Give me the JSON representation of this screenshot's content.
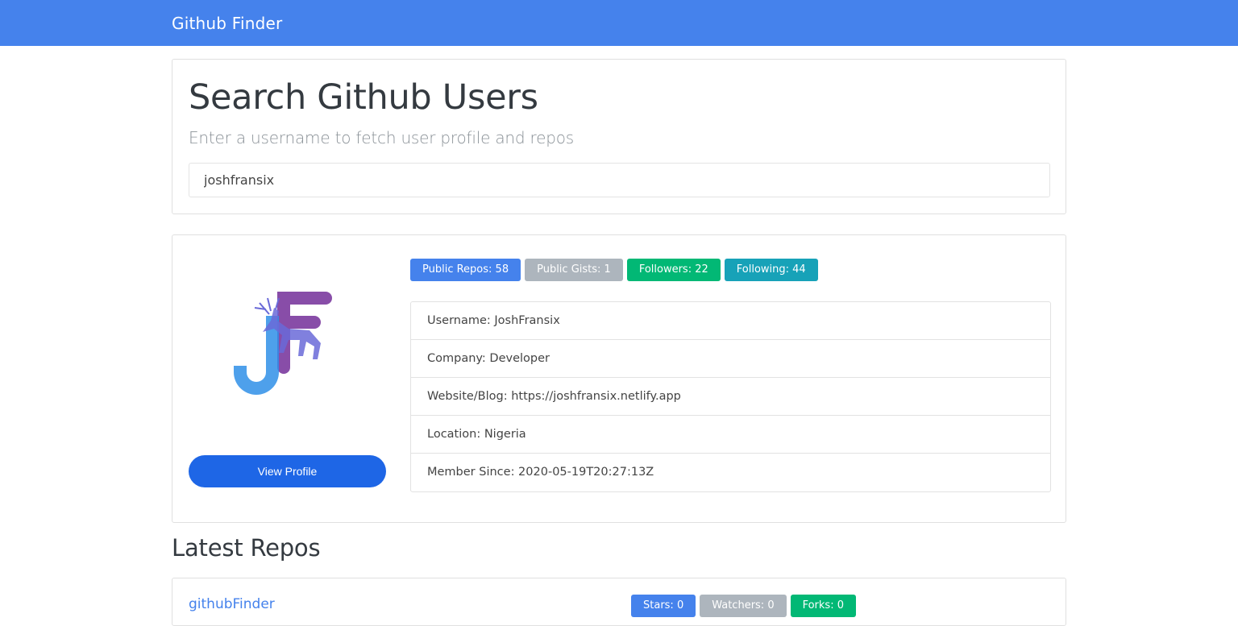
{
  "navbar": {
    "brand": "Github Finder"
  },
  "search": {
    "title": "Search Github Users",
    "subtitle": "Enter a username to fetch user profile and repos",
    "input_value": "joshfransix"
  },
  "profile": {
    "avatar_initials": "JF",
    "view_profile_label": "View Profile",
    "badges": [
      {
        "label": "Public Repos: 58",
        "color": "#4582ec"
      },
      {
        "label": "Public Gists: 1",
        "color": "#adb5bd"
      },
      {
        "label": "Followers: 22",
        "color": "#02b875"
      },
      {
        "label": "Following: 44",
        "color": "#17a2b8"
      }
    ],
    "details": [
      "Username: JoshFransix",
      "Company: Developer",
      "Website/Blog: https://joshfransix.netlify.app",
      "Location: Nigeria",
      "Member Since: 2020-05-19T20:27:13Z"
    ]
  },
  "repos": {
    "heading": "Latest Repos",
    "items": [
      {
        "name": "githubFinder",
        "badges": [
          {
            "label": "Stars: 0",
            "color": "#4582ec"
          },
          {
            "label": "Watchers: 0",
            "color": "#adb5bd"
          },
          {
            "label": "Forks: 0",
            "color": "#02b875"
          }
        ]
      }
    ]
  },
  "colors": {
    "primary": "#4582ec",
    "secondary": "#adb5bd",
    "success": "#02b875",
    "info": "#17a2b8"
  }
}
